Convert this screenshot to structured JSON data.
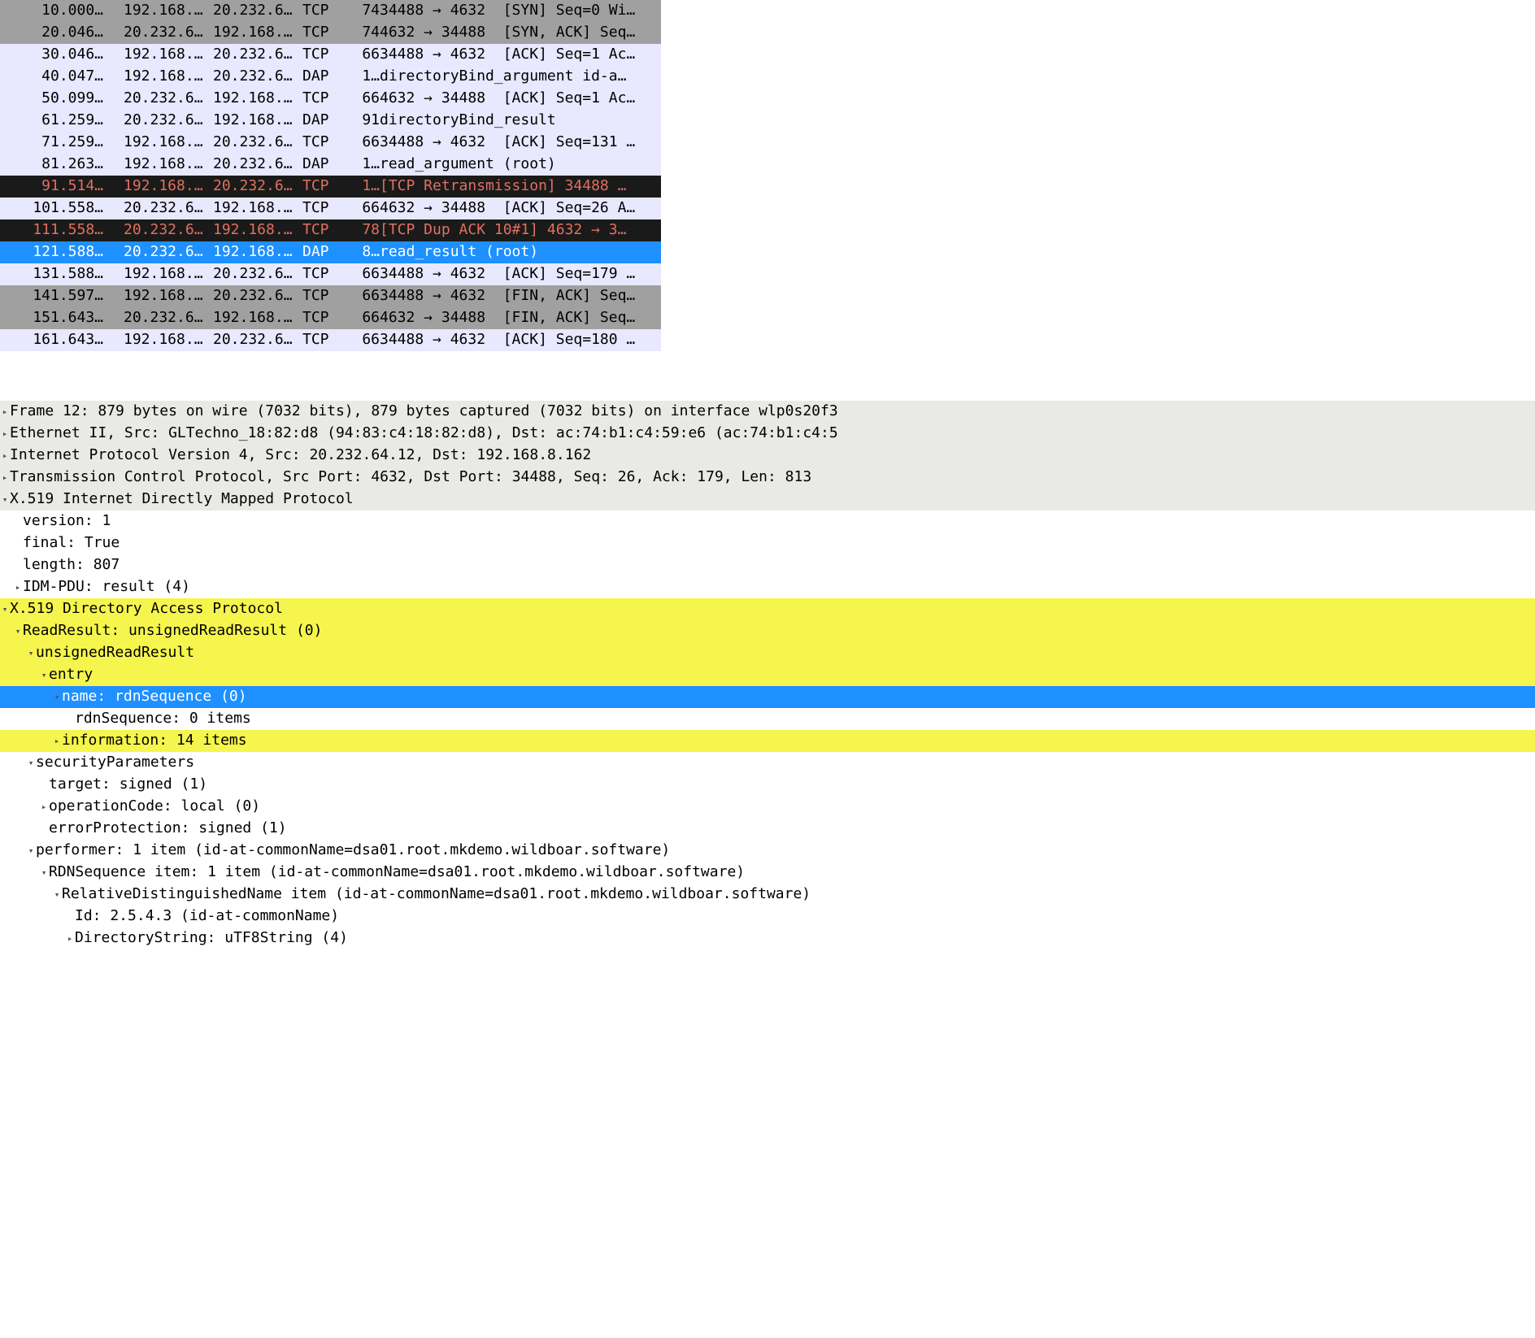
{
  "packets": [
    {
      "no": 1,
      "time": "0.000…",
      "src": "192.168.…",
      "dst": "20.232.6…",
      "proto": "TCP",
      "len": "74",
      "info": "34488 → 4632  [SYN] Seq=0 Wi…",
      "style": "gray"
    },
    {
      "no": 2,
      "time": "0.046…",
      "src": "20.232.6…",
      "dst": "192.168.…",
      "proto": "TCP",
      "len": "74",
      "info": "4632 → 34488  [SYN, ACK] Seq…",
      "style": "gray"
    },
    {
      "no": 3,
      "time": "0.046…",
      "src": "192.168.…",
      "dst": "20.232.6…",
      "proto": "TCP",
      "len": "66",
      "info": "34488 → 4632  [ACK] Seq=1 Ac…",
      "style": "normal"
    },
    {
      "no": 4,
      "time": "0.047…",
      "src": "192.168.…",
      "dst": "20.232.6…",
      "proto": "DAP",
      "len": "1…",
      "info": "directoryBind_argument id-a…",
      "style": "normal"
    },
    {
      "no": 5,
      "time": "0.099…",
      "src": "20.232.6…",
      "dst": "192.168.…",
      "proto": "TCP",
      "len": "66",
      "info": "4632 → 34488  [ACK] Seq=1 Ac…",
      "style": "normal"
    },
    {
      "no": 6,
      "time": "1.259…",
      "src": "20.232.6…",
      "dst": "192.168.…",
      "proto": "DAP",
      "len": "91",
      "info": "directoryBind_result",
      "style": "normal"
    },
    {
      "no": 7,
      "time": "1.259…",
      "src": "192.168.…",
      "dst": "20.232.6…",
      "proto": "TCP",
      "len": "66",
      "info": "34488 → 4632  [ACK] Seq=131 …",
      "style": "normal"
    },
    {
      "no": 8,
      "time": "1.263…",
      "src": "192.168.…",
      "dst": "20.232.6…",
      "proto": "DAP",
      "len": "1…",
      "info": "read_argument (root)",
      "style": "normal"
    },
    {
      "no": 9,
      "time": "1.514…",
      "src": "192.168.…",
      "dst": "20.232.6…",
      "proto": "TCP",
      "len": "1…",
      "info": "[TCP Retransmission] 34488 …",
      "style": "black"
    },
    {
      "no": 10,
      "time": "1.558…",
      "src": "20.232.6…",
      "dst": "192.168.…",
      "proto": "TCP",
      "len": "66",
      "info": "4632 → 34488  [ACK] Seq=26 A…",
      "style": "normal"
    },
    {
      "no": 11,
      "time": "1.558…",
      "src": "20.232.6…",
      "dst": "192.168.…",
      "proto": "TCP",
      "len": "78",
      "info": "[TCP Dup ACK 10#1] 4632 → 3…",
      "style": "blacksel"
    },
    {
      "no": 12,
      "time": "1.588…",
      "src": "20.232.6…",
      "dst": "192.168.…",
      "proto": "DAP",
      "len": "8…",
      "info": "read_result (root)",
      "style": "selected"
    },
    {
      "no": 13,
      "time": "1.588…",
      "src": "192.168.…",
      "dst": "20.232.6…",
      "proto": "TCP",
      "len": "66",
      "info": "34488 → 4632  [ACK] Seq=179 …",
      "style": "normal"
    },
    {
      "no": 14,
      "time": "1.597…",
      "src": "192.168.…",
      "dst": "20.232.6…",
      "proto": "TCP",
      "len": "66",
      "info": "34488 → 4632  [FIN, ACK] Seq…",
      "style": "gray"
    },
    {
      "no": 15,
      "time": "1.643…",
      "src": "20.232.6…",
      "dst": "192.168.…",
      "proto": "TCP",
      "len": "66",
      "info": "4632 → 34488  [FIN, ACK] Seq…",
      "style": "gray"
    },
    {
      "no": 16,
      "time": "1.643…",
      "src": "192.168.…",
      "dst": "20.232.6…",
      "proto": "TCP",
      "len": "66",
      "info": "34488 → 4632  [ACK] Seq=180 …",
      "style": "normal"
    }
  ],
  "tree": [
    {
      "indent": 0,
      "arrow": "▸",
      "text": "Frame 12: 879 bytes on wire (7032 bits), 879 bytes captured (7032 bits) on interface wlp0s20f3",
      "hl": "gray"
    },
    {
      "indent": 0,
      "arrow": "▸",
      "text": "Ethernet II, Src: GLTechno_18:82:d8 (94:83:c4:18:82:d8), Dst: ac:74:b1:c4:59:e6 (ac:74:b1:c4:5",
      "hl": "gray"
    },
    {
      "indent": 0,
      "arrow": "▸",
      "text": "Internet Protocol Version 4, Src: 20.232.64.12, Dst: 192.168.8.162",
      "hl": "gray"
    },
    {
      "indent": 0,
      "arrow": "▸",
      "text": "Transmission Control Protocol, Src Port: 4632, Dst Port: 34488, Seq: 26, Ack: 179, Len: 813",
      "hl": "gray"
    },
    {
      "indent": 0,
      "arrow": "▾",
      "text": "X.519 Internet Directly Mapped Protocol",
      "hl": "gray"
    },
    {
      "indent": 1,
      "arrow": "",
      "text": "version: 1",
      "hl": ""
    },
    {
      "indent": 1,
      "arrow": "",
      "text": "final: True",
      "hl": ""
    },
    {
      "indent": 1,
      "arrow": "",
      "text": "length: 807",
      "hl": ""
    },
    {
      "indent": 1,
      "arrow": "▸",
      "text": "IDM-PDU: result (4)",
      "hl": ""
    },
    {
      "indent": 0,
      "arrow": "▾",
      "text": "X.519 Directory Access Protocol",
      "hl": "yellow"
    },
    {
      "indent": 1,
      "arrow": "▾",
      "text": "ReadResult: unsignedReadResult (0)",
      "hl": "yellow"
    },
    {
      "indent": 2,
      "arrow": "▾",
      "text": "unsignedReadResult",
      "hl": "yellow"
    },
    {
      "indent": 3,
      "arrow": "▾",
      "text": "entry",
      "hl": "yellow"
    },
    {
      "indent": 4,
      "arrow": "▾",
      "text": "name: rdnSequence (0)",
      "hl": "blue"
    },
    {
      "indent": 5,
      "arrow": "",
      "text": "rdnSequence: 0 items",
      "hl": ""
    },
    {
      "indent": 4,
      "arrow": "▸",
      "text": "information: 14 items",
      "hl": "yellow"
    },
    {
      "indent": 2,
      "arrow": "▾",
      "text": "securityParameters",
      "hl": ""
    },
    {
      "indent": 3,
      "arrow": "",
      "text": "target: signed (1)",
      "hl": ""
    },
    {
      "indent": 3,
      "arrow": "▸",
      "text": "operationCode: local (0)",
      "hl": ""
    },
    {
      "indent": 3,
      "arrow": "",
      "text": "errorProtection: signed (1)",
      "hl": ""
    },
    {
      "indent": 2,
      "arrow": "▾",
      "text": "performer: 1 item (id-at-commonName=dsa01.root.mkdemo.wildboar.software)",
      "hl": ""
    },
    {
      "indent": 3,
      "arrow": "▾",
      "text": "RDNSequence item: 1 item (id-at-commonName=dsa01.root.mkdemo.wildboar.software)",
      "hl": ""
    },
    {
      "indent": 4,
      "arrow": "▾",
      "text": "RelativeDistinguishedName item (id-at-commonName=dsa01.root.mkdemo.wildboar.software)",
      "hl": ""
    },
    {
      "indent": 5,
      "arrow": "",
      "text": "Id: 2.5.4.3 (id-at-commonName)",
      "hl": ""
    },
    {
      "indent": 5,
      "arrow": "▸",
      "text": "DirectoryString: uTF8String (4)",
      "hl": ""
    }
  ]
}
